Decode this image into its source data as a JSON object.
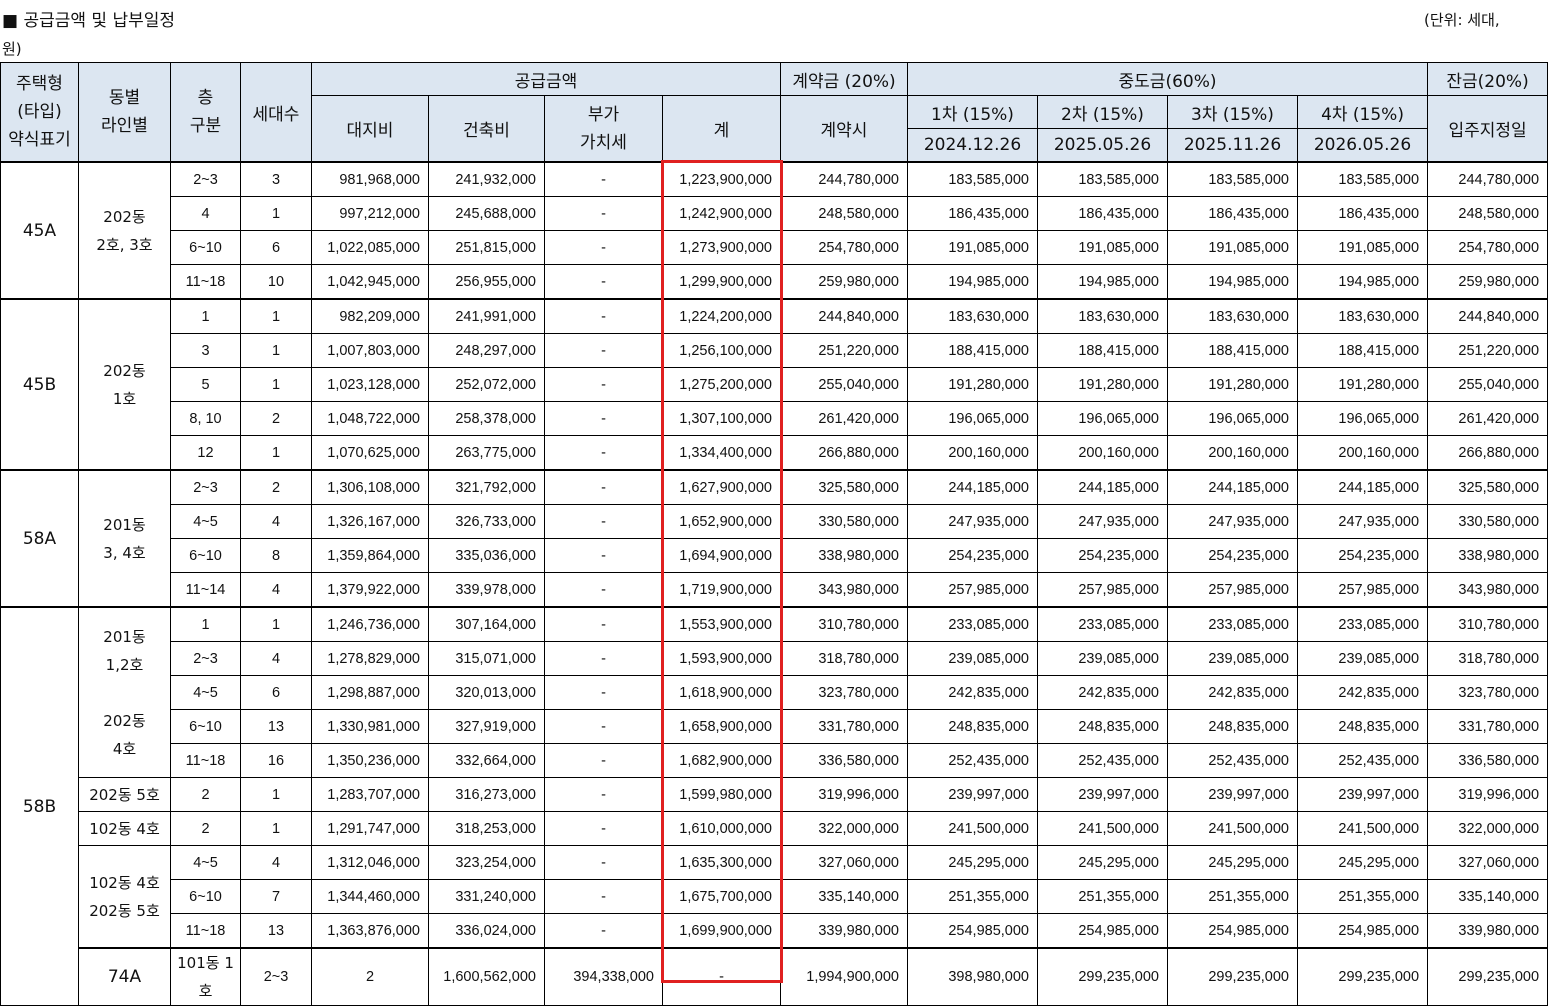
{
  "title": "■ 공급금액 및 납부일정",
  "unit": {
    "line1": "(단위: 세대,",
    "line2": "원)"
  },
  "header": {
    "type_lines": [
      "주택형",
      "(타입)",
      "약식표기"
    ],
    "dong_lines": [
      "동별",
      "라인별"
    ],
    "floor_lines": [
      "층",
      "구분"
    ],
    "households": "세대수",
    "supply": "공급금액",
    "land": "대지비",
    "building": "건축비",
    "vat_lines": [
      "부가",
      "가치세"
    ],
    "total": "계",
    "deposit": "계약금 (20%)",
    "deposit_sub": "계약시",
    "middle": "중도금(60%)",
    "m1": "1차 (15%)",
    "m1_date": "2024.12.26",
    "m2": "2차 (15%)",
    "m2_date": "2025.05.26",
    "m3": "3차 (15%)",
    "m3_date": "2025.11.26",
    "m4": "4차 (15%)",
    "m4_date": "2026.05.26",
    "balance": "잔금(20%)",
    "balance_sub": "입주지정일"
  },
  "groups": {
    "g45a": {
      "type": "45A",
      "dong": [
        "202동",
        "2호, 3호"
      ]
    },
    "g45b": {
      "type": "45B",
      "dong": [
        "202동",
        "1호"
      ]
    },
    "g58a": {
      "type": "58A",
      "dong": [
        "201동",
        "3, 4호"
      ]
    },
    "g58b": {
      "type": "58B",
      "dong1_top": [
        "201동",
        "1,2호"
      ],
      "dong1_bottom": [
        "202동",
        "4호"
      ],
      "dong2": "202동 5호",
      "dong3": "102동 4호",
      "dong4": [
        "102동 4호",
        "202동 5호"
      ]
    },
    "g74a": {
      "type": "74A",
      "dong": "101동 1호"
    }
  },
  "rows": [
    {
      "floor": "2~3",
      "hh": "3",
      "land": "981,968,000",
      "build": "241,932,000",
      "vat": "-",
      "total": "1,223,900,000",
      "dep": "244,780,000",
      "m1": "183,585,000",
      "m2": "183,585,000",
      "m3": "183,585,000",
      "m4": "183,585,000",
      "bal": "244,780,000"
    },
    {
      "floor": "4",
      "hh": "1",
      "land": "997,212,000",
      "build": "245,688,000",
      "vat": "-",
      "total": "1,242,900,000",
      "dep": "248,580,000",
      "m1": "186,435,000",
      "m2": "186,435,000",
      "m3": "186,435,000",
      "m4": "186,435,000",
      "bal": "248,580,000"
    },
    {
      "floor": "6~10",
      "hh": "6",
      "land": "1,022,085,000",
      "build": "251,815,000",
      "vat": "-",
      "total": "1,273,900,000",
      "dep": "254,780,000",
      "m1": "191,085,000",
      "m2": "191,085,000",
      "m3": "191,085,000",
      "m4": "191,085,000",
      "bal": "254,780,000"
    },
    {
      "floor": "11~18",
      "hh": "10",
      "land": "1,042,945,000",
      "build": "256,955,000",
      "vat": "-",
      "total": "1,299,900,000",
      "dep": "259,980,000",
      "m1": "194,985,000",
      "m2": "194,985,000",
      "m3": "194,985,000",
      "m4": "194,985,000",
      "bal": "259,980,000"
    },
    {
      "floor": "1",
      "hh": "1",
      "land": "982,209,000",
      "build": "241,991,000",
      "vat": "-",
      "total": "1,224,200,000",
      "dep": "244,840,000",
      "m1": "183,630,000",
      "m2": "183,630,000",
      "m3": "183,630,000",
      "m4": "183,630,000",
      "bal": "244,840,000"
    },
    {
      "floor": "3",
      "hh": "1",
      "land": "1,007,803,000",
      "build": "248,297,000",
      "vat": "-",
      "total": "1,256,100,000",
      "dep": "251,220,000",
      "m1": "188,415,000",
      "m2": "188,415,000",
      "m3": "188,415,000",
      "m4": "188,415,000",
      "bal": "251,220,000"
    },
    {
      "floor": "5",
      "hh": "1",
      "land": "1,023,128,000",
      "build": "252,072,000",
      "vat": "-",
      "total": "1,275,200,000",
      "dep": "255,040,000",
      "m1": "191,280,000",
      "m2": "191,280,000",
      "m3": "191,280,000",
      "m4": "191,280,000",
      "bal": "255,040,000"
    },
    {
      "floor": "8, 10",
      "hh": "2",
      "land": "1,048,722,000",
      "build": "258,378,000",
      "vat": "-",
      "total": "1,307,100,000",
      "dep": "261,420,000",
      "m1": "196,065,000",
      "m2": "196,065,000",
      "m3": "196,065,000",
      "m4": "196,065,000",
      "bal": "261,420,000"
    },
    {
      "floor": "12",
      "hh": "1",
      "land": "1,070,625,000",
      "build": "263,775,000",
      "vat": "-",
      "total": "1,334,400,000",
      "dep": "266,880,000",
      "m1": "200,160,000",
      "m2": "200,160,000",
      "m3": "200,160,000",
      "m4": "200,160,000",
      "bal": "266,880,000"
    },
    {
      "floor": "2~3",
      "hh": "2",
      "land": "1,306,108,000",
      "build": "321,792,000",
      "vat": "-",
      "total": "1,627,900,000",
      "dep": "325,580,000",
      "m1": "244,185,000",
      "m2": "244,185,000",
      "m3": "244,185,000",
      "m4": "244,185,000",
      "bal": "325,580,000"
    },
    {
      "floor": "4~5",
      "hh": "4",
      "land": "1,326,167,000",
      "build": "326,733,000",
      "vat": "-",
      "total": "1,652,900,000",
      "dep": "330,580,000",
      "m1": "247,935,000",
      "m2": "247,935,000",
      "m3": "247,935,000",
      "m4": "247,935,000",
      "bal": "330,580,000"
    },
    {
      "floor": "6~10",
      "hh": "8",
      "land": "1,359,864,000",
      "build": "335,036,000",
      "vat": "-",
      "total": "1,694,900,000",
      "dep": "338,980,000",
      "m1": "254,235,000",
      "m2": "254,235,000",
      "m3": "254,235,000",
      "m4": "254,235,000",
      "bal": "338,980,000"
    },
    {
      "floor": "11~14",
      "hh": "4",
      "land": "1,379,922,000",
      "build": "339,978,000",
      "vat": "-",
      "total": "1,719,900,000",
      "dep": "343,980,000",
      "m1": "257,985,000",
      "m2": "257,985,000",
      "m3": "257,985,000",
      "m4": "257,985,000",
      "bal": "343,980,000"
    },
    {
      "floor": "1",
      "hh": "1",
      "land": "1,246,736,000",
      "build": "307,164,000",
      "vat": "-",
      "total": "1,553,900,000",
      "dep": "310,780,000",
      "m1": "233,085,000",
      "m2": "233,085,000",
      "m3": "233,085,000",
      "m4": "233,085,000",
      "bal": "310,780,000"
    },
    {
      "floor": "2~3",
      "hh": "4",
      "land": "1,278,829,000",
      "build": "315,071,000",
      "vat": "-",
      "total": "1,593,900,000",
      "dep": "318,780,000",
      "m1": "239,085,000",
      "m2": "239,085,000",
      "m3": "239,085,000",
      "m4": "239,085,000",
      "bal": "318,780,000"
    },
    {
      "floor": "4~5",
      "hh": "6",
      "land": "1,298,887,000",
      "build": "320,013,000",
      "vat": "-",
      "total": "1,618,900,000",
      "dep": "323,780,000",
      "m1": "242,835,000",
      "m2": "242,835,000",
      "m3": "242,835,000",
      "m4": "242,835,000",
      "bal": "323,780,000"
    },
    {
      "floor": "6~10",
      "hh": "13",
      "land": "1,330,981,000",
      "build": "327,919,000",
      "vat": "-",
      "total": "1,658,900,000",
      "dep": "331,780,000",
      "m1": "248,835,000",
      "m2": "248,835,000",
      "m3": "248,835,000",
      "m4": "248,835,000",
      "bal": "331,780,000"
    },
    {
      "floor": "11~18",
      "hh": "16",
      "land": "1,350,236,000",
      "build": "332,664,000",
      "vat": "-",
      "total": "1,682,900,000",
      "dep": "336,580,000",
      "m1": "252,435,000",
      "m2": "252,435,000",
      "m3": "252,435,000",
      "m4": "252,435,000",
      "bal": "336,580,000"
    },
    {
      "floor": "2",
      "hh": "1",
      "land": "1,283,707,000",
      "build": "316,273,000",
      "vat": "-",
      "total": "1,599,980,000",
      "dep": "319,996,000",
      "m1": "239,997,000",
      "m2": "239,997,000",
      "m3": "239,997,000",
      "m4": "239,997,000",
      "bal": "319,996,000"
    },
    {
      "floor": "2",
      "hh": "1",
      "land": "1,291,747,000",
      "build": "318,253,000",
      "vat": "-",
      "total": "1,610,000,000",
      "dep": "322,000,000",
      "m1": "241,500,000",
      "m2": "241,500,000",
      "m3": "241,500,000",
      "m4": "241,500,000",
      "bal": "322,000,000"
    },
    {
      "floor": "4~5",
      "hh": "4",
      "land": "1,312,046,000",
      "build": "323,254,000",
      "vat": "-",
      "total": "1,635,300,000",
      "dep": "327,060,000",
      "m1": "245,295,000",
      "m2": "245,295,000",
      "m3": "245,295,000",
      "m4": "245,295,000",
      "bal": "327,060,000"
    },
    {
      "floor": "6~10",
      "hh": "7",
      "land": "1,344,460,000",
      "build": "331,240,000",
      "vat": "-",
      "total": "1,675,700,000",
      "dep": "335,140,000",
      "m1": "251,355,000",
      "m2": "251,355,000",
      "m3": "251,355,000",
      "m4": "251,355,000",
      "bal": "335,140,000"
    },
    {
      "floor": "11~18",
      "hh": "13",
      "land": "1,363,876,000",
      "build": "336,024,000",
      "vat": "-",
      "total": "1,699,900,000",
      "dep": "339,980,000",
      "m1": "254,985,000",
      "m2": "254,985,000",
      "m3": "254,985,000",
      "m4": "254,985,000",
      "bal": "339,980,000"
    },
    {
      "floor": "2~3",
      "hh": "2",
      "land": "1,600,562,000",
      "build": "394,338,000",
      "vat": "-",
      "total": "1,994,900,000",
      "dep": "398,980,000",
      "m1": "299,235,000",
      "m2": "299,235,000",
      "m3": "299,235,000",
      "m4": "299,235,000",
      "bal": "398,980,000"
    }
  ],
  "highlight": {
    "column": "계",
    "color": "#e02020"
  }
}
